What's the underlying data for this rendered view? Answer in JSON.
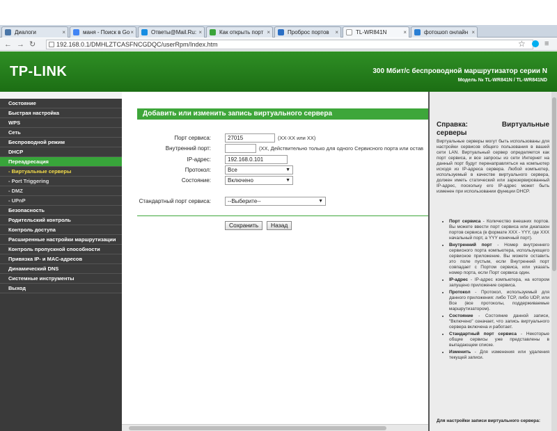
{
  "browser": {
    "tabs": [
      {
        "label": "Диалоги"
      },
      {
        "label": "маня - Поиск в Go"
      },
      {
        "label": "Ответы@Mail.Ru:"
      },
      {
        "label": "Как открыть порт"
      },
      {
        "label": "Проброс портов"
      },
      {
        "label": "TL-WR841N"
      },
      {
        "label": "фотошоп онлайн"
      }
    ],
    "url": "192.168.0.1/DMHLZTCASFNCGDQC/userRpm/Index.htm"
  },
  "header": {
    "logo": "TP-LINK",
    "title": "300 Мбит/с беспроводной маршрутизатор серии N",
    "model": "Модель № TL-WR841N / TL-WR841ND"
  },
  "sidebar": {
    "items": [
      {
        "label": "Состояние"
      },
      {
        "label": "Быстрая настройка"
      },
      {
        "label": "WPS"
      },
      {
        "label": "Сеть"
      },
      {
        "label": "Беспроводной режим"
      },
      {
        "label": "DHCP"
      },
      {
        "label": "Переадресация"
      },
      {
        "label": "- Виртуальные серверы"
      },
      {
        "label": "- Port Triggering"
      },
      {
        "label": "- DMZ"
      },
      {
        "label": "- UPnP"
      },
      {
        "label": "Безопасность"
      },
      {
        "label": "Родительский контроль"
      },
      {
        "label": "Контроль доступа"
      },
      {
        "label": "Расширенные настройки маршрутизации"
      },
      {
        "label": "Контроль пропускной способности"
      },
      {
        "label": "Привязка IP- и MAC-адресов"
      },
      {
        "label": "Динамический DNS"
      },
      {
        "label": "Системные инструменты"
      },
      {
        "label": "Выход"
      }
    ]
  },
  "form": {
    "title": "Добавить или изменить запись виртуального сервера",
    "service_port_label": "Порт сервиса:",
    "service_port_value": "27015",
    "service_port_hint": "(XX-XX или XX)",
    "internal_port_label": "Внутренний порт:",
    "internal_port_value": "",
    "internal_port_hint": "(XX, Действительно только для одного Сервисного порта или остав",
    "ip_label": "IP-адрес:",
    "ip_value": "192.168.0.101",
    "protocol_label": "Протокол:",
    "protocol_value": "Все",
    "status_label": "Состояние:",
    "status_value": "Включено",
    "std_port_label": "Стандартный порт сервиса:",
    "std_port_value": "--Выберите--",
    "save_label": "Сохранить",
    "back_label": "Назад"
  },
  "help": {
    "title_left": "Справка:",
    "title_right": "Виртуальные",
    "title_line2": "серверы",
    "intro": "Виртуальные серверы могут быть использованы для настройки сервисов общего пользования в вашей сети LAN. Виртуальный сервер определяется как порт сервиса, и все запросы из сети Интернет на данный порт будут перенаправляться на компьютер исходя из IP-адреса сервера. Любой компьютер, используемый в качестве виртуального сервера, должен иметь статический или зарезервированный IP-адрес, поскольку его IP-адрес может быть изменен при использовании функции DHCP.",
    "items": [
      {
        "term": "Порт сервиса",
        "text": " - Количество внешних портов. Вы можете ввести порт сервиса или диапазон портов сервиса (в формате XXX - YYY, где XXX начальный порт, а YYY конечный порт)."
      },
      {
        "term": "Внутренний порт",
        "text": " - Номер внутреннего сервисного порта компьютера, использующего сервисное приложение. Вы можете оставить это поле пустым, если Внутренний порт совпадает с Портом сервиса, или указать номер порта, если Порт сервиса один."
      },
      {
        "term": "IP-адрес",
        "text": " - IP-адрес компьютера, на котором запущено приложение сервиса."
      },
      {
        "term": "Протокол",
        "text": " - Протокол, используемый для данного приложения: либо TCP, либо UDP, или Все (все протоколы, поддерживаемые маршрутизатором)."
      },
      {
        "term": "Состояние",
        "text": " - Состояние данной записи, \"Включено\" означает, что запись виртуального сервера включена и работает."
      },
      {
        "term": "Стандартный порт сервиса",
        "text": " - Некоторые общие сервисы уже представлены в выпадающем списке."
      },
      {
        "term": "Изменить",
        "text": " - Для изменения или удаления текущей записи."
      }
    ],
    "footer": "Для настройки записи виртуального сервера:"
  }
}
